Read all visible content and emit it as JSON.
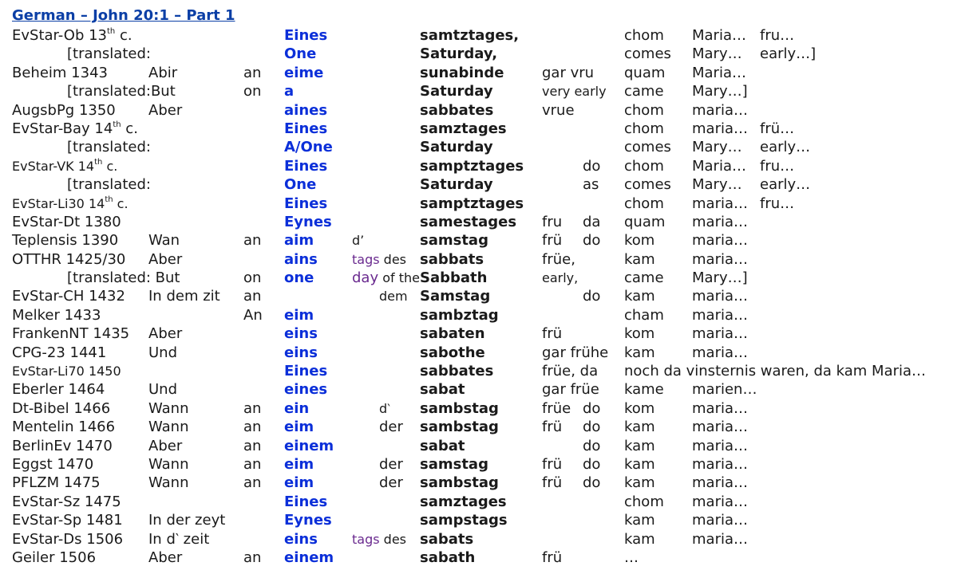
{
  "title": "German – John 20:1 – Part 1",
  "rows": [
    {
      "c0": "EvStar-Ob 13",
      "c0sup": "th",
      "c0suf": " c.",
      "c3": "Eines",
      "c5": "samtztages,",
      "c8": "chom",
      "c9": "Maria…",
      "c10": "fru…"
    },
    {
      "c0": "[translated:",
      "ind": true,
      "c3": "One",
      "c5": "Saturday,",
      "c8": "comes",
      "c9": "Mary…",
      "c10": "early…]"
    },
    {
      "c0": "Beheim 1343",
      "c1": "Abir",
      "c2": "an",
      "c3": "eime",
      "c5": "sunabinde",
      "c6": "gar vru",
      "c8": "quam",
      "c9": "Maria…"
    },
    {
      "c0": "[translated:But",
      "ind": true,
      "c2": "on",
      "c3": "a",
      "c5": "Saturday",
      "c6": "very early",
      "c6small": true,
      "c8": "came",
      "c9": "Mary…]"
    },
    {
      "c0": "AugsbPg 1350",
      "c1": "Aber",
      "c3": "aines",
      "c5": "sabbates",
      "c6": "vrue",
      "c8": "chom",
      "c9": "maria…"
    },
    {
      "c0": "EvStar-Bay 14",
      "c0sup": "th",
      "c0suf": " c.",
      "c3": "Eines",
      "c5": "samztages",
      "c8": "chom",
      "c9": "maria…",
      "c10": "frü…"
    },
    {
      "c0": "[translated:",
      "ind": true,
      "c3": "A/One",
      "c5": "Saturday",
      "c8": "comes",
      "c9": "Mary…",
      "c10": "early…"
    },
    {
      "c0": "EvStar-VK 14",
      "c0sup": "th",
      "c0suf": " c.",
      "c0small": true,
      "c3": "Eines",
      "c5": "samptztages",
      "c7": "do",
      "c8": "chom",
      "c9": "Maria…",
      "c10": "fru…"
    },
    {
      "c0": "[translated:",
      "ind": true,
      "c3": "One",
      "c5": "Saturday",
      "c7": "as",
      "c8": "comes",
      "c9": "Mary…",
      "c10": "early…"
    },
    {
      "c0": "EvStar-Li30 14",
      "c0sup": "th",
      "c0suf": " c.",
      "c0small": true,
      "c3": "Eines",
      "c5": "samptztages",
      "c8": "chom",
      "c9": "maria…",
      "c10": "fru…"
    },
    {
      "c0": "EvStar-Dt 1380",
      "c3": "Eynes",
      "c5": "samestages",
      "c6": "fru",
      "c7": "da",
      "c8": "quam",
      "c9": "maria…"
    },
    {
      "c0": "Teplensis 1390",
      "c1": "Wan",
      "c2": "an",
      "c3": "aim",
      "c4": "d’",
      "c5": "samstag",
      "c6": "frü",
      "c7": "do",
      "c8": "kom",
      "c9": "maria…"
    },
    {
      "c0": "OTTHR 1425/30",
      "c1": "Aber",
      "c3": "ains",
      "c4a": "tags",
      "c4b": " des",
      "c5": "sabbats",
      "c6": "früe,",
      "c8": "kam",
      "c9": "maria…"
    },
    {
      "c0": "[translated: But",
      "ind": true,
      "c2": "on",
      "c3": "one",
      "c4a": "day",
      "c4b": " of the",
      "c5": "Sabbath",
      "c6": "early,",
      "c6small": true,
      "c8": "came",
      "c9": "Mary…]"
    },
    {
      "c0": "EvStar-CH 1432",
      "c1": "In dem zit",
      "c2": "an",
      "c4": "dem",
      "c4pad": true,
      "c5": "Samstag",
      "c7": "do",
      "c8": "kam",
      "c9": "maria…"
    },
    {
      "c0": "Melker 1433",
      "c2": "An",
      "c3": "eim",
      "c5": "sambztag",
      "c8": "cham",
      "c9": "maria…"
    },
    {
      "c0": "FrankenNT 1435",
      "c1": "Aber",
      "c3": "eins",
      "c5": "sabaten",
      "c6": "frü",
      "c8": "kom",
      "c9": "maria…"
    },
    {
      "c0": "CPG-23 1441",
      "c1": "Und",
      "c3": "eins",
      "c5": "sabothe",
      "c6": "gar frühe",
      "c8": "kam",
      "c9": "maria…"
    },
    {
      "c0": "EvStar-Li70 1450",
      "c0small": true,
      "c3": "Eines",
      "c5": "sabbates",
      "c6": "früe, da",
      "c8": "noch da vinsternis waren, da kam Maria…"
    },
    {
      "c0": "Eberler 1464",
      "c1": "Und",
      "c3": "eines",
      "c5": "sabat",
      "c6": "gar früe",
      "c8": "kame",
      "c9": "marien…"
    },
    {
      "c0": "Dt-Bibel 1466",
      "c1": "Wann",
      "c2": "an",
      "c3": "ein",
      "c4": "d‵",
      "c4pad": true,
      "c5": "sambstag",
      "c6": "früe",
      "c7": "do",
      "c8": "kom",
      "c9": "maria…"
    },
    {
      "c0": "Mentelin 1466",
      "c1": "Wann",
      "c2": "an",
      "c3": "eim",
      "c4": "der",
      "c4pad": true,
      "c4big": true,
      "c5": "sambstag",
      "c6": "frü",
      "c7": "do",
      "c8": "kam",
      "c9": "maria…"
    },
    {
      "c0": "BerlinEv 1470",
      "c1": "Aber",
      "c2": "an",
      "c3": "einem",
      "c5": "sabat",
      "c7": "do",
      "c8": "kam",
      "c9": "maria…"
    },
    {
      "c0": "Eggst 1470",
      "c1": "Wann",
      "c2": "an",
      "c3": "eim",
      "c4": "der",
      "c4pad": true,
      "c4big": true,
      "c5": "samstag",
      "c6": "frü",
      "c7": "do",
      "c8": "kam",
      "c9": "maria…"
    },
    {
      "c0": "PFLZM 1475",
      "c1": "Wann",
      "c2": "an",
      "c3": "eim",
      "c4": "der",
      "c4pad": true,
      "c4big": true,
      "c5": "sambstag",
      "c6": "frü",
      "c7": "do",
      "c8": "kam",
      "c9": "maria…"
    },
    {
      "c0": "EvStar-Sz 1475",
      "c3": "Eines",
      "c5": "samztages",
      "c8": "chom",
      "c9": "maria…"
    },
    {
      "c0": "EvStar-Sp 1481",
      "c1": "In der zeyt",
      "c3": "Eynes",
      "c5": "sampstags",
      "c8": "kam",
      "c9": "maria…"
    },
    {
      "c0": "EvStar-Ds 1506",
      "c1": "In d‵ zeit",
      "c3": "eins",
      "c4a": "tags",
      "c4b": " des",
      "c5": "sabats",
      "c8": "kam",
      "c9": "maria…"
    },
    {
      "c0": "Geiler 1506",
      "c1": "Aber",
      "c2": "an",
      "c3": "einem",
      "c5": "sabath",
      "c6": "frü",
      "c8": "…"
    }
  ]
}
